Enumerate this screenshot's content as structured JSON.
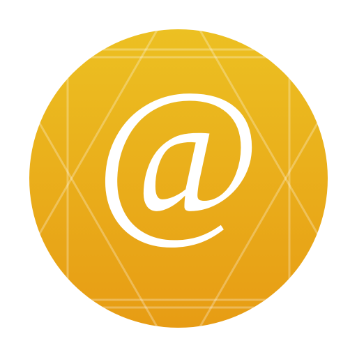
{
  "icon": {
    "name": "at-sign-icon",
    "glyph": "@",
    "gradient_top": "#ECC022",
    "gradient_bottom": "#E79C14",
    "glyph_color": "#FFFFFF",
    "pattern_color": "#FFFFFF"
  }
}
